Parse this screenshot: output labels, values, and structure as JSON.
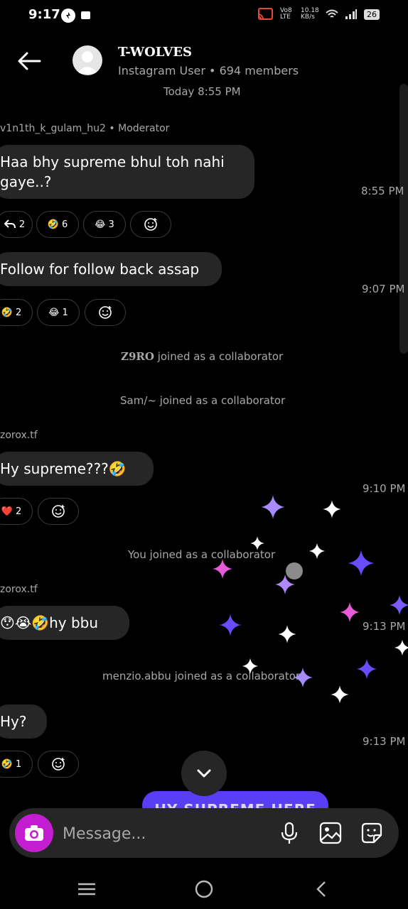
{
  "status_bar": {
    "time": "9:17",
    "network_speed": "10.18 KB/s",
    "volte": "Vo8 LTE",
    "battery": "26"
  },
  "header": {
    "title": "T-WOLVES",
    "subtitle": "Instagram User • 694 members"
  },
  "chat": {
    "date_divider": "Today 8:55 PM",
    "messages": [
      {
        "sender": "v1n1th_k_gulam_hu2 • Moderator",
        "line1": "Haa bhy supreme bhul toh nahi",
        "line2": "gaye..?",
        "time": "8:55 PM",
        "reactions": [
          {
            "icon": "reply-icon",
            "count": "2"
          },
          {
            "emoji": "🤣",
            "count": "6"
          },
          {
            "emoji": "😂",
            "count": "3"
          }
        ]
      },
      {
        "text": "Follow for follow back assap",
        "time": "9:07 PM",
        "reactions": [
          {
            "emoji": "🤣",
            "count": "2"
          },
          {
            "emoji": "😂",
            "count": "1"
          }
        ]
      },
      {
        "sender": "zorox.tf",
        "text": "Hy supreme???🤣",
        "time": "9:10 PM",
        "reactions": [
          {
            "emoji": "❤️",
            "count": "2"
          }
        ]
      },
      {
        "sender": "zorox.tf",
        "text": "😯😭🤣hy bbu",
        "time": "9:13 PM"
      },
      {
        "text": "Hy?",
        "time": "9:13 PM",
        "reactions": [
          {
            "emoji": "🤣",
            "count": "1"
          }
        ]
      }
    ],
    "system": {
      "z9ro_name": "Z9RO",
      "z9ro_text": " joined as a collaborator",
      "sam": "Sam/~ joined as a collaborator",
      "you": "You joined as a collaborator",
      "menzio": "menzio.abbu joined as a collaborator"
    },
    "blue_pill_text": "HY SUPREME HERE"
  },
  "composer": {
    "placeholder": "Message..."
  },
  "colors": {
    "background": "#000000",
    "bubble": "#262626",
    "secondary_text": "#a8a8a8",
    "camera": "#c21ecf",
    "blue_pill": "#5a3ef5"
  }
}
